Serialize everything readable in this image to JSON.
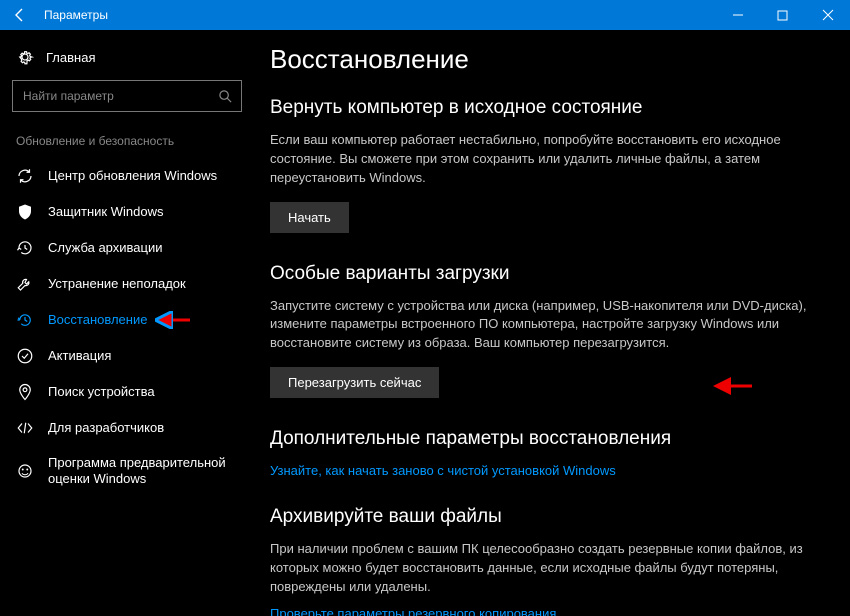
{
  "titlebar": {
    "title": "Параметры"
  },
  "home_label": "Главная",
  "search": {
    "placeholder": "Найти параметр"
  },
  "category": "Обновление и безопасность",
  "nav": [
    {
      "label": "Центр обновления Windows"
    },
    {
      "label": "Защитник Windows"
    },
    {
      "label": "Служба архивации"
    },
    {
      "label": "Устранение неполадок"
    },
    {
      "label": "Восстановление"
    },
    {
      "label": "Активация"
    },
    {
      "label": "Поиск устройства"
    },
    {
      "label": "Для разработчиков"
    },
    {
      "label": "Программа предварительной оценки Windows"
    }
  ],
  "main": {
    "title": "Восстановление",
    "s1": {
      "heading": "Вернуть компьютер в исходное состояние",
      "text": "Если ваш компьютер работает нестабильно, попробуйте восстановить его исходное состояние. Вы сможете при этом сохранить или удалить личные файлы, а затем переустановить Windows.",
      "button": "Начать"
    },
    "s2": {
      "heading": "Особые варианты загрузки",
      "text": "Запустите систему с устройства или диска (например, USB-накопителя или DVD-диска), измените параметры встроенного ПО компьютера, настройте загрузку Windows или восстановите систему из образа. Ваш компьютер перезагрузится.",
      "button": "Перезагрузить сейчас"
    },
    "s3": {
      "heading": "Дополнительные параметры восстановления",
      "link": "Узнайте, как начать заново с чистой установкой Windows"
    },
    "s4": {
      "heading": "Архивируйте ваши файлы",
      "text": "При наличии проблем с вашим ПК целесообразно создать резервные копии файлов, из которых можно будет восстановить данные, если исходные файлы будут потеряны, повреждены или удалены.",
      "link": "Проверьте параметры резервного копирования"
    }
  }
}
